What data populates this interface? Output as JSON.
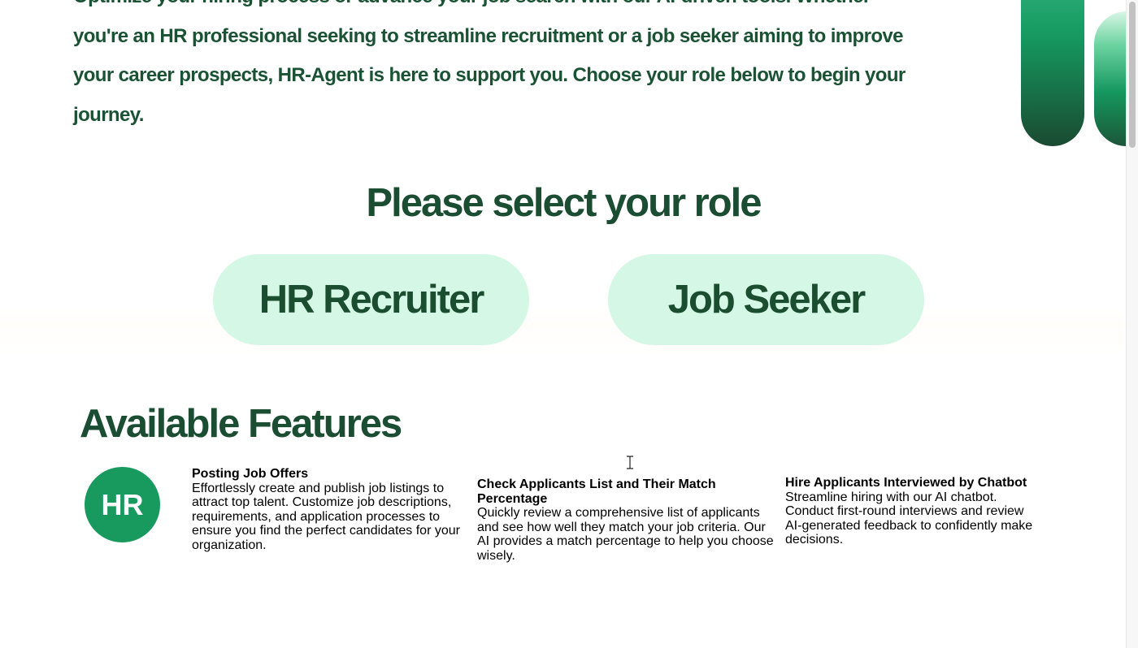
{
  "intro": {
    "text": "Optimize your hiring process or advance your job search with our AI-driven tools. Whether you're an HR professional seeking to streamline recruitment or a job seeker aiming to improve your career prospects, HR-Agent is here to support you. Choose your role below to begin your journey."
  },
  "roles": {
    "heading": "Please select your role",
    "hr_label": "HR Recruiter",
    "seeker_label": "Job Seeker"
  },
  "features": {
    "heading": "Available Features",
    "badge": "HR",
    "items": [
      {
        "title": "Posting Job Offers",
        "desc": "Effortlessly create and publish job listings to attract top talent. Customize job descriptions, requirements, and application processes to ensure you find the perfect candidates for your organization."
      },
      {
        "title": "Check Applicants List and Their Match Percentage",
        "desc": "Quickly review a comprehensive list of applicants and see how well they match your job criteria. Our AI provides a match percentage to help you choose wisely."
      },
      {
        "title": "Hire Applicants Interviewed by Chatbot",
        "desc": "Streamline hiring with our AI chatbot. Conduct first-round interviews and review AI-generated feedback to confidently make decisions."
      }
    ]
  },
  "colors": {
    "primary_dark_green": "#1a4d31",
    "button_mint": "#d5f7e5",
    "badge_green": "#189a5f"
  },
  "cursor": {
    "icon": "text-cursor-icon"
  }
}
